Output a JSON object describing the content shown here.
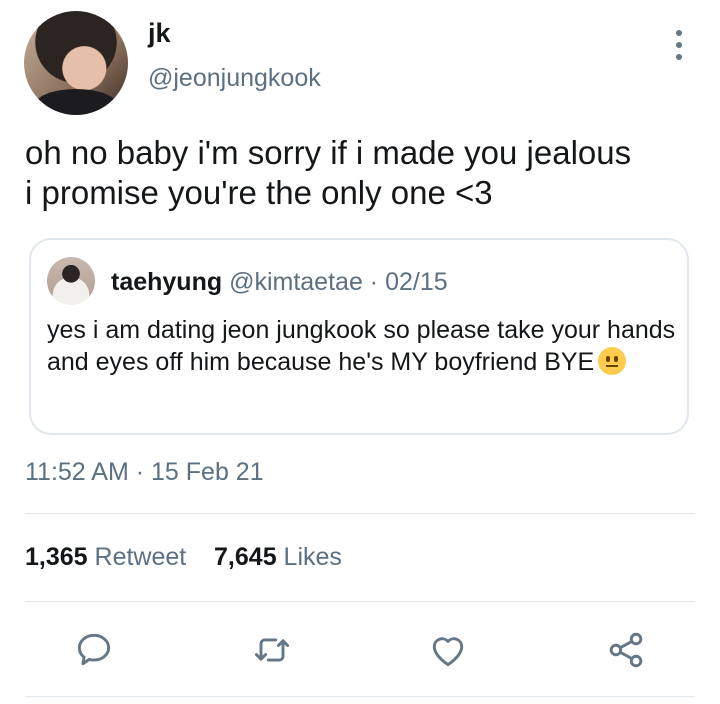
{
  "author": {
    "display_name": "jk",
    "handle": "@jeonjungkook"
  },
  "tweet": {
    "text": "oh no baby i'm sorry if i made you jealous\ni promise you're the only one <3",
    "time": "11:52 AM",
    "date": "15 Feb 21",
    "separator": "·"
  },
  "quote": {
    "name": "taehyung",
    "handle": "@kimtaetae",
    "date": "02/15",
    "separator": "·",
    "text": "yes i am dating jeon jungkook so please take your hands and eyes off him because he's MY boyfriend BYE",
    "emoji_icon": "neutral-face-emoji"
  },
  "stats": {
    "retweets": "1,365",
    "retweets_label": "Retweet",
    "likes": "7,645",
    "likes_label": "Likes"
  },
  "actions": {
    "icons": [
      "comment-icon",
      "retweet-icon",
      "heart-icon",
      "share-icon"
    ],
    "color": "#657786"
  },
  "colors": {
    "text": "#14171a",
    "muted": "#5b7083",
    "border": "#e1e8ed"
  }
}
